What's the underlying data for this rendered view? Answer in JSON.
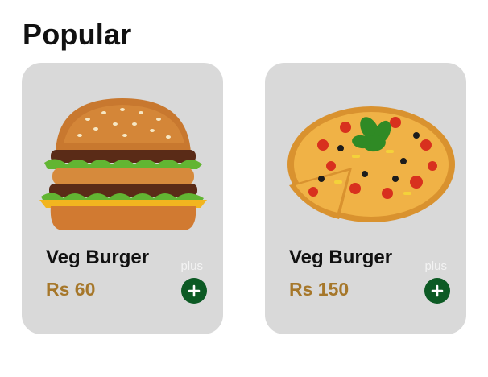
{
  "section": {
    "title": "Popular"
  },
  "items": [
    {
      "name": "Veg Burger",
      "price": "Rs 60",
      "plus_text": "plus",
      "image_icon": "burger-image"
    },
    {
      "name": "Veg Burger",
      "price": "Rs 150",
      "plus_text": "plus",
      "image_icon": "pizza-image"
    }
  ],
  "colors": {
    "card_bg": "#d9d9d9",
    "price": "#a6772a",
    "add_button": "#0c5a24",
    "title": "#111111"
  }
}
